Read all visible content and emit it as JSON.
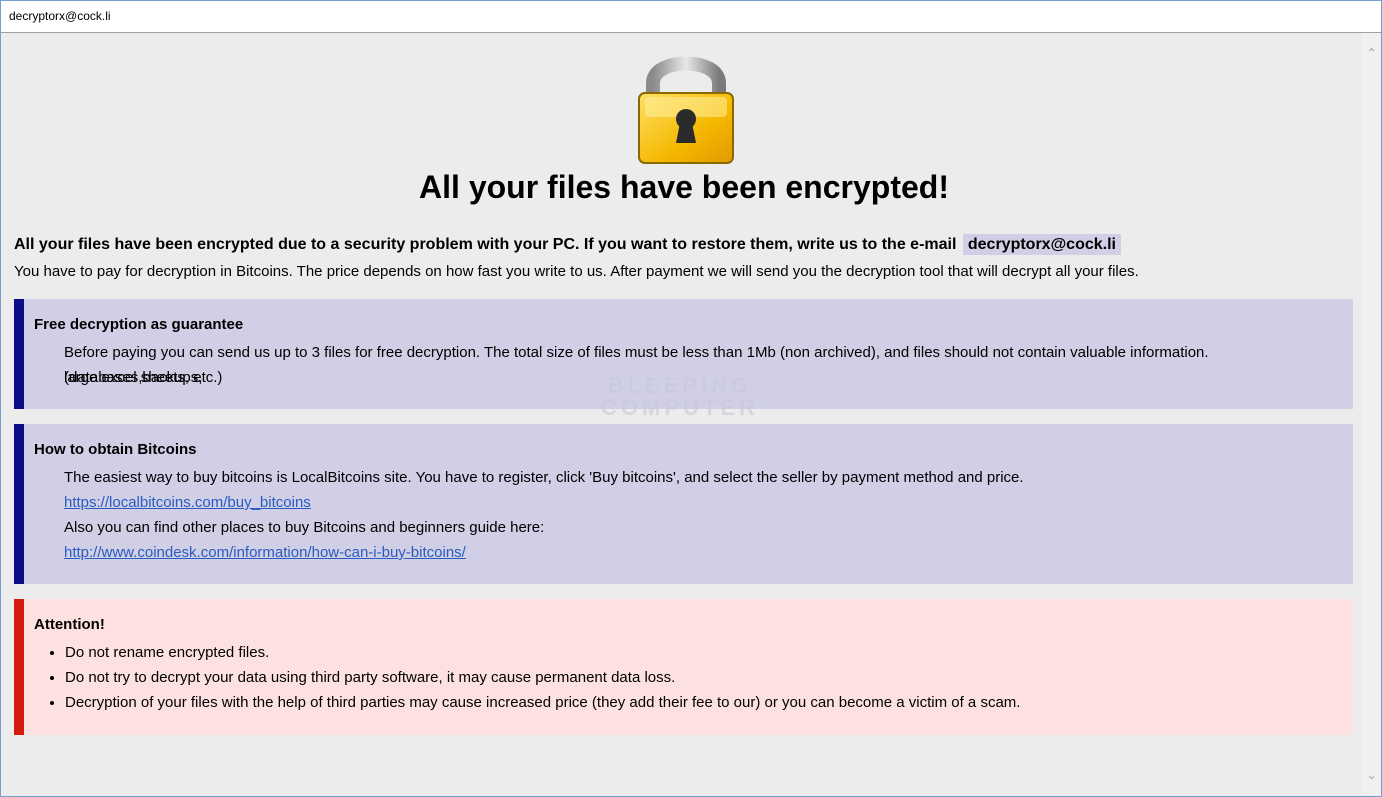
{
  "window": {
    "title": "decryptorx@cock.li"
  },
  "heading": "All your files have been encrypted!",
  "intro": {
    "line1": "All your files have been encrypted due to a security problem with your PC. If you want to restore them, write us to the e-mail",
    "email": "decryptorx@cock.li",
    "line2": "You have to pay for decryption in Bitcoins. The price depends on how fast you write to us. After payment we will send you the decryption tool that will decrypt all your files."
  },
  "free_decryption": {
    "title": "Free decryption as guarantee",
    "text_line1": "Before paying you can send us up to 3 files for free decryption. The total size of files must be less than 1Mb (non archived), and files should not contain valuable information. (databases,backups,",
    "text_line2": "large excel sheets, etc.)"
  },
  "bitcoins": {
    "title": "How to obtain Bitcoins",
    "line1": "The easiest way to buy bitcoins is LocalBitcoins site. You have to register, click 'Buy bitcoins', and select the seller by payment method and price.",
    "link1": "https://localbitcoins.com/buy_bitcoins",
    "line2": "Also you can find other places to buy Bitcoins and beginners guide here:",
    "link2": "http://www.coindesk.com/information/how-can-i-buy-bitcoins/"
  },
  "attention": {
    "title": "Attention!",
    "items": [
      "Do not rename encrypted files.",
      "Do not try to decrypt your data using third party software, it may cause permanent data loss.",
      "Decryption of your files with the help of third parties may cause increased price (they add their fee to our) or you can become a victim of a scam."
    ]
  },
  "watermark": {
    "line1": "BLEEPING",
    "line2": "COMPUTER"
  },
  "icons": {
    "lock": "padlock-icon",
    "scroll_up": "chevron-up-icon",
    "scroll_down": "chevron-down-icon"
  },
  "colors": {
    "info_box_bg": "#d0cfe6",
    "info_box_bar": "#0d0d8a",
    "attention_box_bg": "#fde1e1",
    "attention_box_bar": "#d61a0f",
    "link": "#2a5bbf"
  }
}
